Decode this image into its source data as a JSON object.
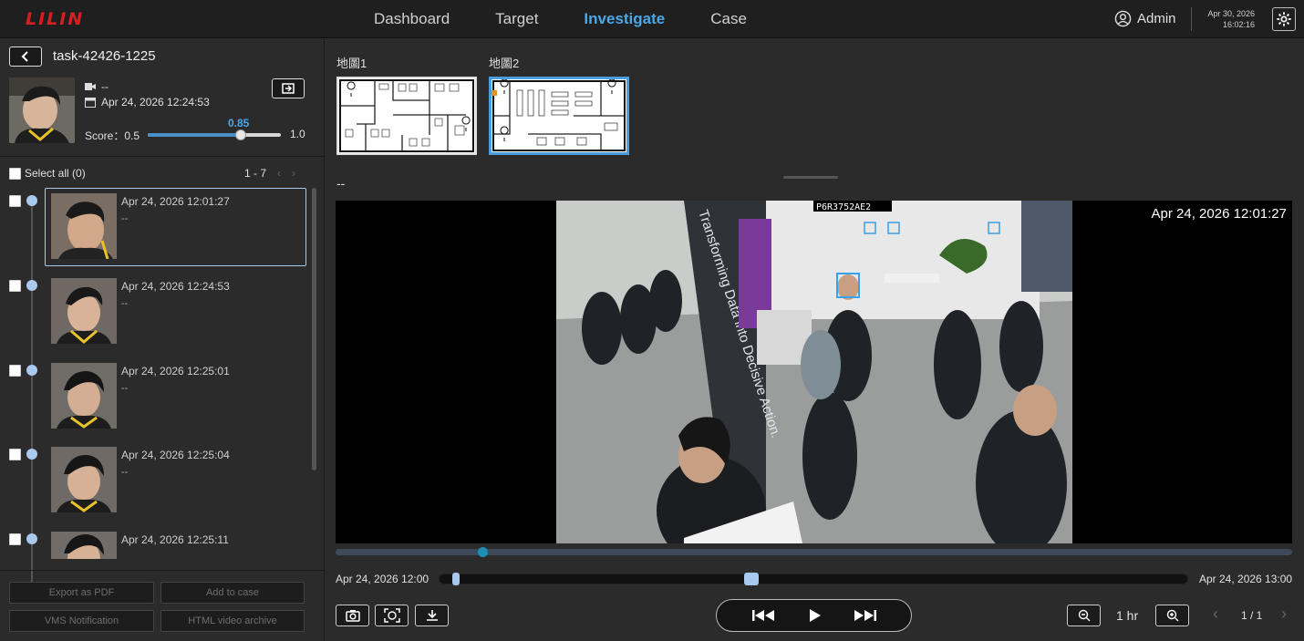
{
  "header": {
    "logo": "LILIN",
    "nav": [
      "Dashboard",
      "Target",
      "Investigate",
      "Case"
    ],
    "active_nav": "Investigate",
    "user": "Admin",
    "date": "Apr 30, 2026",
    "time": "16:02:16",
    "icons": [
      "user-icon",
      "gear-icon"
    ]
  },
  "task": {
    "title": "task-42426-1225",
    "camera": "--",
    "datetime": "Apr 24, 2026 12:24:53",
    "score_label": "Score：0.5",
    "score_value": "0.85",
    "score_max": "1.0",
    "score_fraction": 0.7
  },
  "results": {
    "select_all": "Select all (0)",
    "paging": "1 - 7",
    "items": [
      {
        "time": "Apr 24, 2026 12:01:27",
        "sub": "--",
        "selected": true
      },
      {
        "time": "Apr 24, 2026 12:24:53",
        "sub": "--",
        "selected": false
      },
      {
        "time": "Apr 24, 2026 12:25:01",
        "sub": "--",
        "selected": false
      },
      {
        "time": "Apr 24, 2026 12:25:04",
        "sub": "--",
        "selected": false
      },
      {
        "time": "Apr 24, 2026 12:25:11",
        "sub": "",
        "selected": false
      }
    ]
  },
  "actions": {
    "export_pdf": "Export as PDF",
    "add_case": "Add to case",
    "vms": "VMS Notification",
    "html_archive": "HTML video archive"
  },
  "maps": [
    {
      "label": "地圖1"
    },
    {
      "label": "地圖2"
    }
  ],
  "video": {
    "camera_label": "--",
    "timestamp": "Apr 24, 2026 12:01:27",
    "booth_text": "Transforming Data into Decisive Action.",
    "plate": "P6R3752AE2"
  },
  "timeline": {
    "start": "Apr 24, 2026 12:00",
    "end": "Apr 24, 2026 13:00",
    "zoom": "1 hr",
    "page": "1 / 1"
  }
}
